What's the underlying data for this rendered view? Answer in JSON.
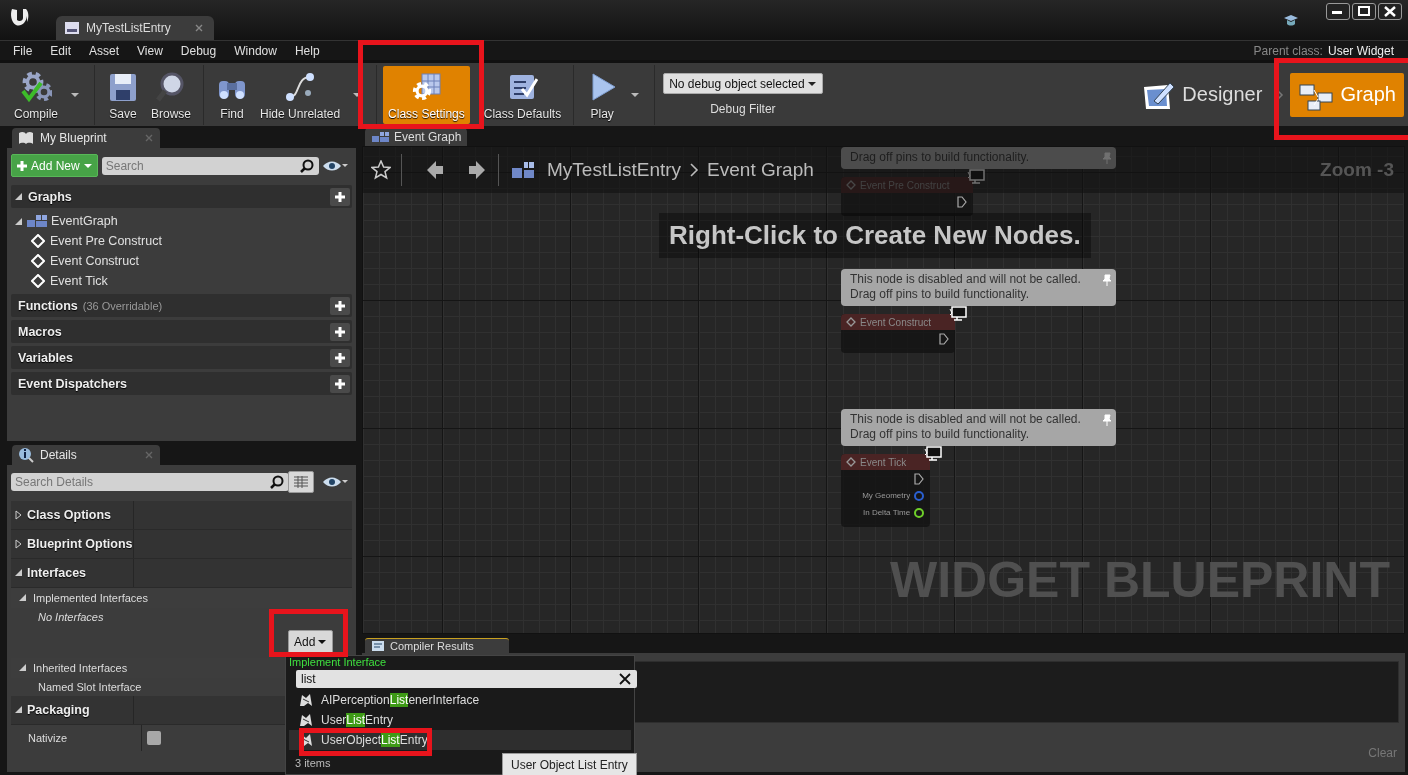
{
  "window": {
    "tab_title": "MyTestListEntry"
  },
  "menu": [
    "File",
    "Edit",
    "Asset",
    "View",
    "Debug",
    "Window",
    "Help"
  ],
  "parent_class": {
    "label": "Parent class:",
    "value": "User Widget"
  },
  "toolbar": {
    "groups": [
      [
        {
          "kind": "compile",
          "label": "Compile",
          "dropdown": true,
          "active": false
        }
      ],
      [
        {
          "kind": "save",
          "label": "Save",
          "dropdown": false,
          "active": false
        },
        {
          "kind": "browse",
          "label": "Browse",
          "dropdown": false,
          "active": false
        }
      ],
      [
        {
          "kind": "find",
          "label": "Find",
          "dropdown": false,
          "active": false
        },
        {
          "kind": "hide_unrelated",
          "label": "Hide Unrelated",
          "dropdown": true,
          "active": false
        }
      ],
      [
        {
          "kind": "class_settings",
          "label": "Class Settings",
          "dropdown": false,
          "active": true
        },
        {
          "kind": "class_defaults",
          "label": "Class Defaults",
          "dropdown": false,
          "active": false
        }
      ],
      [
        {
          "kind": "play",
          "label": "Play",
          "dropdown": true,
          "active": false
        }
      ]
    ],
    "debug_filter": {
      "value": "No debug object selected",
      "label": "Debug Filter"
    },
    "modes": [
      {
        "kind": "designer",
        "label": "Designer",
        "selected": false
      },
      {
        "kind": "graph",
        "label": "Graph",
        "selected": true
      }
    ]
  },
  "my_blueprint": {
    "tab": "My Blueprint",
    "add_new": "Add New",
    "search": {
      "placeholder": "Search"
    },
    "sections": [
      {
        "title": "Graphs",
        "children": [
          {
            "label": "EventGraph",
            "kind": "graph",
            "children": [
              {
                "label": "Event Pre Construct",
                "kind": "event"
              },
              {
                "label": "Event Construct",
                "kind": "event"
              },
              {
                "label": "Event Tick",
                "kind": "event"
              }
            ]
          }
        ]
      },
      {
        "title": "Functions",
        "note": "(36 Overridable)"
      },
      {
        "title": "Macros"
      },
      {
        "title": "Variables"
      },
      {
        "title": "Event Dispatchers"
      }
    ]
  },
  "details": {
    "tab": "Details",
    "search": {
      "placeholder": "Search Details"
    },
    "categories": [
      {
        "title": "Class Options",
        "expanded": false
      },
      {
        "title": "Blueprint Options",
        "expanded": false
      },
      {
        "title": "Interfaces",
        "expanded": true,
        "groups": [
          {
            "title": "Implemented Interfaces",
            "expanded": true,
            "rows": [
              {
                "kind": "empty",
                "text": "No Interfaces"
              }
            ],
            "add_button": {
              "label": "Add"
            }
          },
          {
            "title": "Inherited Interfaces",
            "expanded": true,
            "rows": [
              {
                "kind": "item",
                "text": "Named Slot Interface"
              }
            ]
          }
        ]
      },
      {
        "title": "Packaging",
        "expanded": true,
        "properties": [
          {
            "name": "Nativize",
            "checked": false
          }
        ]
      }
    ]
  },
  "graph": {
    "tab": "Event Graph",
    "breadcrumb": [
      "MyTestListEntry",
      "Event Graph"
    ],
    "zoom": "Zoom -3",
    "hint": "Right-Click to Create New Nodes.",
    "watermark": "WIDGET BLUEPRINT",
    "nodes": [
      {
        "title": "Event Pre Construct",
        "comment": [
          "Drag off pins to build functionality."
        ]
      },
      {
        "title": "Event Construct",
        "comment": [
          "This node is disabled and will not be called.",
          "Drag off pins to build functionality."
        ]
      },
      {
        "title": "Event Tick",
        "comment": [
          "This node is disabled and will not be called.",
          "Drag off pins to build functionality."
        ],
        "pins": [
          {
            "label": "My Geometry",
            "color": "#2a5fd0"
          },
          {
            "label": "In Delta Time",
            "color": "#6fcf2a"
          }
        ]
      }
    ]
  },
  "compiler_results": {
    "tab": "Compiler Results",
    "clear": "Clear"
  },
  "interface_picker": {
    "title": "Implement Interface",
    "query": "list",
    "items": [
      {
        "before": "AIPerception",
        "match": "List",
        "after": "enerInterface",
        "selected": false
      },
      {
        "before": "User",
        "match": "List",
        "after": "Entry",
        "selected": false
      },
      {
        "before": "UserObject",
        "match": "List",
        "after": "Entry",
        "selected": true
      }
    ],
    "count": "3 items",
    "tooltip": "User Object List Entry"
  },
  "annotations": [
    {
      "kind": "frame"
    },
    {
      "kind": "frame"
    },
    {
      "kind": "frame"
    },
    {
      "kind": "frame"
    }
  ]
}
